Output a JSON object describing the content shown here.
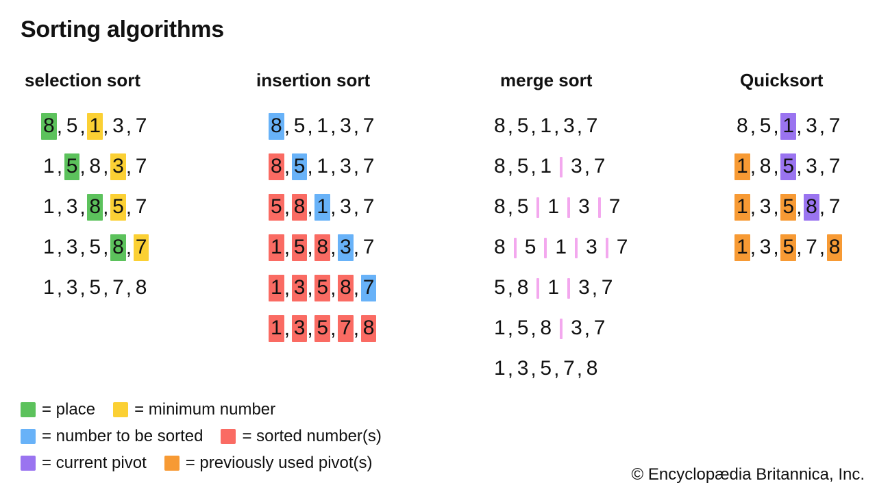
{
  "title": "Sorting algorithms",
  "colors": {
    "place": "#5cc25c",
    "minimum": "#fbd034",
    "to_be_sorted": "#68b2f8",
    "sorted": "#fa6b63",
    "current_pivot": "#9a74f0",
    "previous_pivot": "#f79a34",
    "divider": "#f3a8ee",
    "text": "#111111",
    "background": "#ffffff"
  },
  "columns": [
    {
      "header": "selection sort",
      "rows": [
        [
          {
            "v": "8",
            "hl": "place"
          },
          {
            "v": "5"
          },
          {
            "v": "1",
            "hl": "minimum"
          },
          {
            "v": "3"
          },
          {
            "v": "7"
          }
        ],
        [
          {
            "v": "1"
          },
          {
            "v": "5",
            "hl": "place"
          },
          {
            "v": "8"
          },
          {
            "v": "3",
            "hl": "minimum"
          },
          {
            "v": "7"
          }
        ],
        [
          {
            "v": "1"
          },
          {
            "v": "3"
          },
          {
            "v": "8",
            "hl": "place"
          },
          {
            "v": "5",
            "hl": "minimum"
          },
          {
            "v": "7"
          }
        ],
        [
          {
            "v": "1"
          },
          {
            "v": "3"
          },
          {
            "v": "5"
          },
          {
            "v": "8",
            "hl": "place"
          },
          {
            "v": "7",
            "hl": "minimum"
          }
        ],
        [
          {
            "v": "1"
          },
          {
            "v": "3"
          },
          {
            "v": "5"
          },
          {
            "v": "7"
          },
          {
            "v": "8"
          }
        ]
      ]
    },
    {
      "header": "insertion sort",
      "rows": [
        [
          {
            "v": "8",
            "hl": "to_be_sorted"
          },
          {
            "v": "5"
          },
          {
            "v": "1"
          },
          {
            "v": "3"
          },
          {
            "v": "7"
          }
        ],
        [
          {
            "v": "8",
            "hl": "sorted"
          },
          {
            "v": "5",
            "hl": "to_be_sorted"
          },
          {
            "v": "1"
          },
          {
            "v": "3"
          },
          {
            "v": "7"
          }
        ],
        [
          {
            "v": "5",
            "hl": "sorted"
          },
          {
            "v": "8",
            "hl": "sorted"
          },
          {
            "v": "1",
            "hl": "to_be_sorted"
          },
          {
            "v": "3"
          },
          {
            "v": "7"
          }
        ],
        [
          {
            "v": "1",
            "hl": "sorted"
          },
          {
            "v": "5",
            "hl": "sorted"
          },
          {
            "v": "8",
            "hl": "sorted"
          },
          {
            "v": "3",
            "hl": "to_be_sorted"
          },
          {
            "v": "7"
          }
        ],
        [
          {
            "v": "1",
            "hl": "sorted"
          },
          {
            "v": "3",
            "hl": "sorted"
          },
          {
            "v": "5",
            "hl": "sorted"
          },
          {
            "v": "8",
            "hl": "sorted"
          },
          {
            "v": "7",
            "hl": "to_be_sorted"
          }
        ],
        [
          {
            "v": "1",
            "hl": "sorted"
          },
          {
            "v": "3",
            "hl": "sorted"
          },
          {
            "v": "5",
            "hl": "sorted"
          },
          {
            "v": "7",
            "hl": "sorted"
          },
          {
            "v": "8",
            "hl": "sorted"
          }
        ]
      ]
    },
    {
      "header": "merge sort",
      "rows": [
        [
          {
            "v": "8"
          },
          {
            "v": "5"
          },
          {
            "v": "1"
          },
          {
            "v": "3"
          },
          {
            "v": "7"
          }
        ],
        [
          {
            "v": "8"
          },
          {
            "v": "5"
          },
          {
            "v": "1",
            "after": "divider"
          },
          {
            "v": "3"
          },
          {
            "v": "7"
          }
        ],
        [
          {
            "v": "8"
          },
          {
            "v": "5",
            "after": "divider"
          },
          {
            "v": "1",
            "after": "divider"
          },
          {
            "v": "3",
            "after": "divider"
          },
          {
            "v": "7"
          }
        ],
        [
          {
            "v": "8",
            "after": "divider"
          },
          {
            "v": "5",
            "after": "divider"
          },
          {
            "v": "1",
            "after": "divider"
          },
          {
            "v": "3",
            "after": "divider"
          },
          {
            "v": "7"
          }
        ],
        [
          {
            "v": "5"
          },
          {
            "v": "8",
            "after": "divider"
          },
          {
            "v": "1",
            "after": "divider"
          },
          {
            "v": "3"
          },
          {
            "v": "7"
          }
        ],
        [
          {
            "v": "1"
          },
          {
            "v": "5"
          },
          {
            "v": "8",
            "after": "divider"
          },
          {
            "v": "3"
          },
          {
            "v": "7"
          }
        ],
        [
          {
            "v": "1"
          },
          {
            "v": "3"
          },
          {
            "v": "5"
          },
          {
            "v": "7"
          },
          {
            "v": "8"
          }
        ]
      ]
    },
    {
      "header": "Quicksort",
      "rows": [
        [
          {
            "v": "8"
          },
          {
            "v": "5"
          },
          {
            "v": "1",
            "hl": "current_pivot"
          },
          {
            "v": "3"
          },
          {
            "v": "7"
          }
        ],
        [
          {
            "v": "1",
            "hl": "previous_pivot"
          },
          {
            "v": "8"
          },
          {
            "v": "5",
            "hl": "current_pivot"
          },
          {
            "v": "3"
          },
          {
            "v": "7"
          }
        ],
        [
          {
            "v": "1",
            "hl": "previous_pivot"
          },
          {
            "v": "3"
          },
          {
            "v": "5",
            "hl": "previous_pivot"
          },
          {
            "v": "8",
            "hl": "current_pivot"
          },
          {
            "v": "7"
          }
        ],
        [
          {
            "v": "1",
            "hl": "previous_pivot"
          },
          {
            "v": "3"
          },
          {
            "v": "5",
            "hl": "previous_pivot"
          },
          {
            "v": "7"
          },
          {
            "v": "8",
            "hl": "previous_pivot"
          }
        ]
      ]
    }
  ],
  "legend": {
    "rows": [
      [
        {
          "color_key": "place",
          "label": "= place"
        },
        {
          "color_key": "minimum",
          "label": "= minimum number"
        }
      ],
      [
        {
          "color_key": "to_be_sorted",
          "label": "= number to be sorted"
        },
        {
          "color_key": "sorted",
          "label": "= sorted number(s)"
        }
      ],
      [
        {
          "color_key": "current_pivot",
          "label": "= current pivot"
        },
        {
          "color_key": "previous_pivot",
          "label": "= previously used pivot(s)"
        }
      ]
    ]
  },
  "credit": "© Encyclopædia Britannica, Inc."
}
